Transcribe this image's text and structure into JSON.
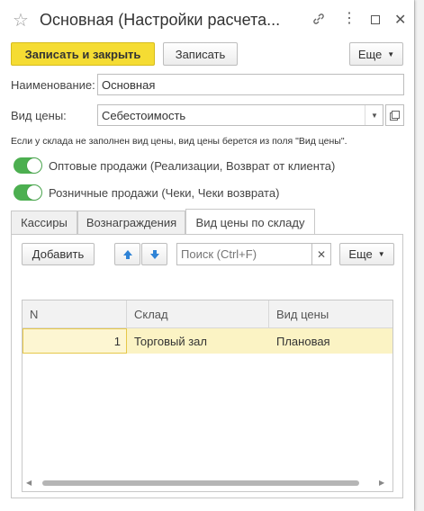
{
  "window": {
    "title": "Основная (Настройки расчета..."
  },
  "toolbar": {
    "save_close": "Записать и закрыть",
    "save": "Записать",
    "more": "Еще"
  },
  "form": {
    "name_label": "Наименование:",
    "name_value": "Основная",
    "price_label": "Вид цены:",
    "price_value": "Себестоимость",
    "note": "Если у склада не заполнен вид цены, вид цены берется из поля \"Вид цены\".",
    "wholesale": "Оптовые продажи (Реализации, Возврат от клиента)",
    "retail": "Розничные продажи (Чеки, Чеки возврата)"
  },
  "tabs": [
    "Кассиры",
    "Вознаграждения",
    "Вид цены по складу"
  ],
  "tab_panel": {
    "add": "Добавить",
    "search_placeholder": "Поиск (Ctrl+F)",
    "more": "Еще",
    "columns": [
      "N",
      "Склад",
      "Вид цены"
    ],
    "rows": [
      {
        "n": "1",
        "warehouse": "Торговый зал",
        "price": "Плановая"
      }
    ]
  },
  "colors": {
    "primary": "#f5dc33",
    "toggle": "#4caf50",
    "selected_row": "#fbf3c4"
  }
}
